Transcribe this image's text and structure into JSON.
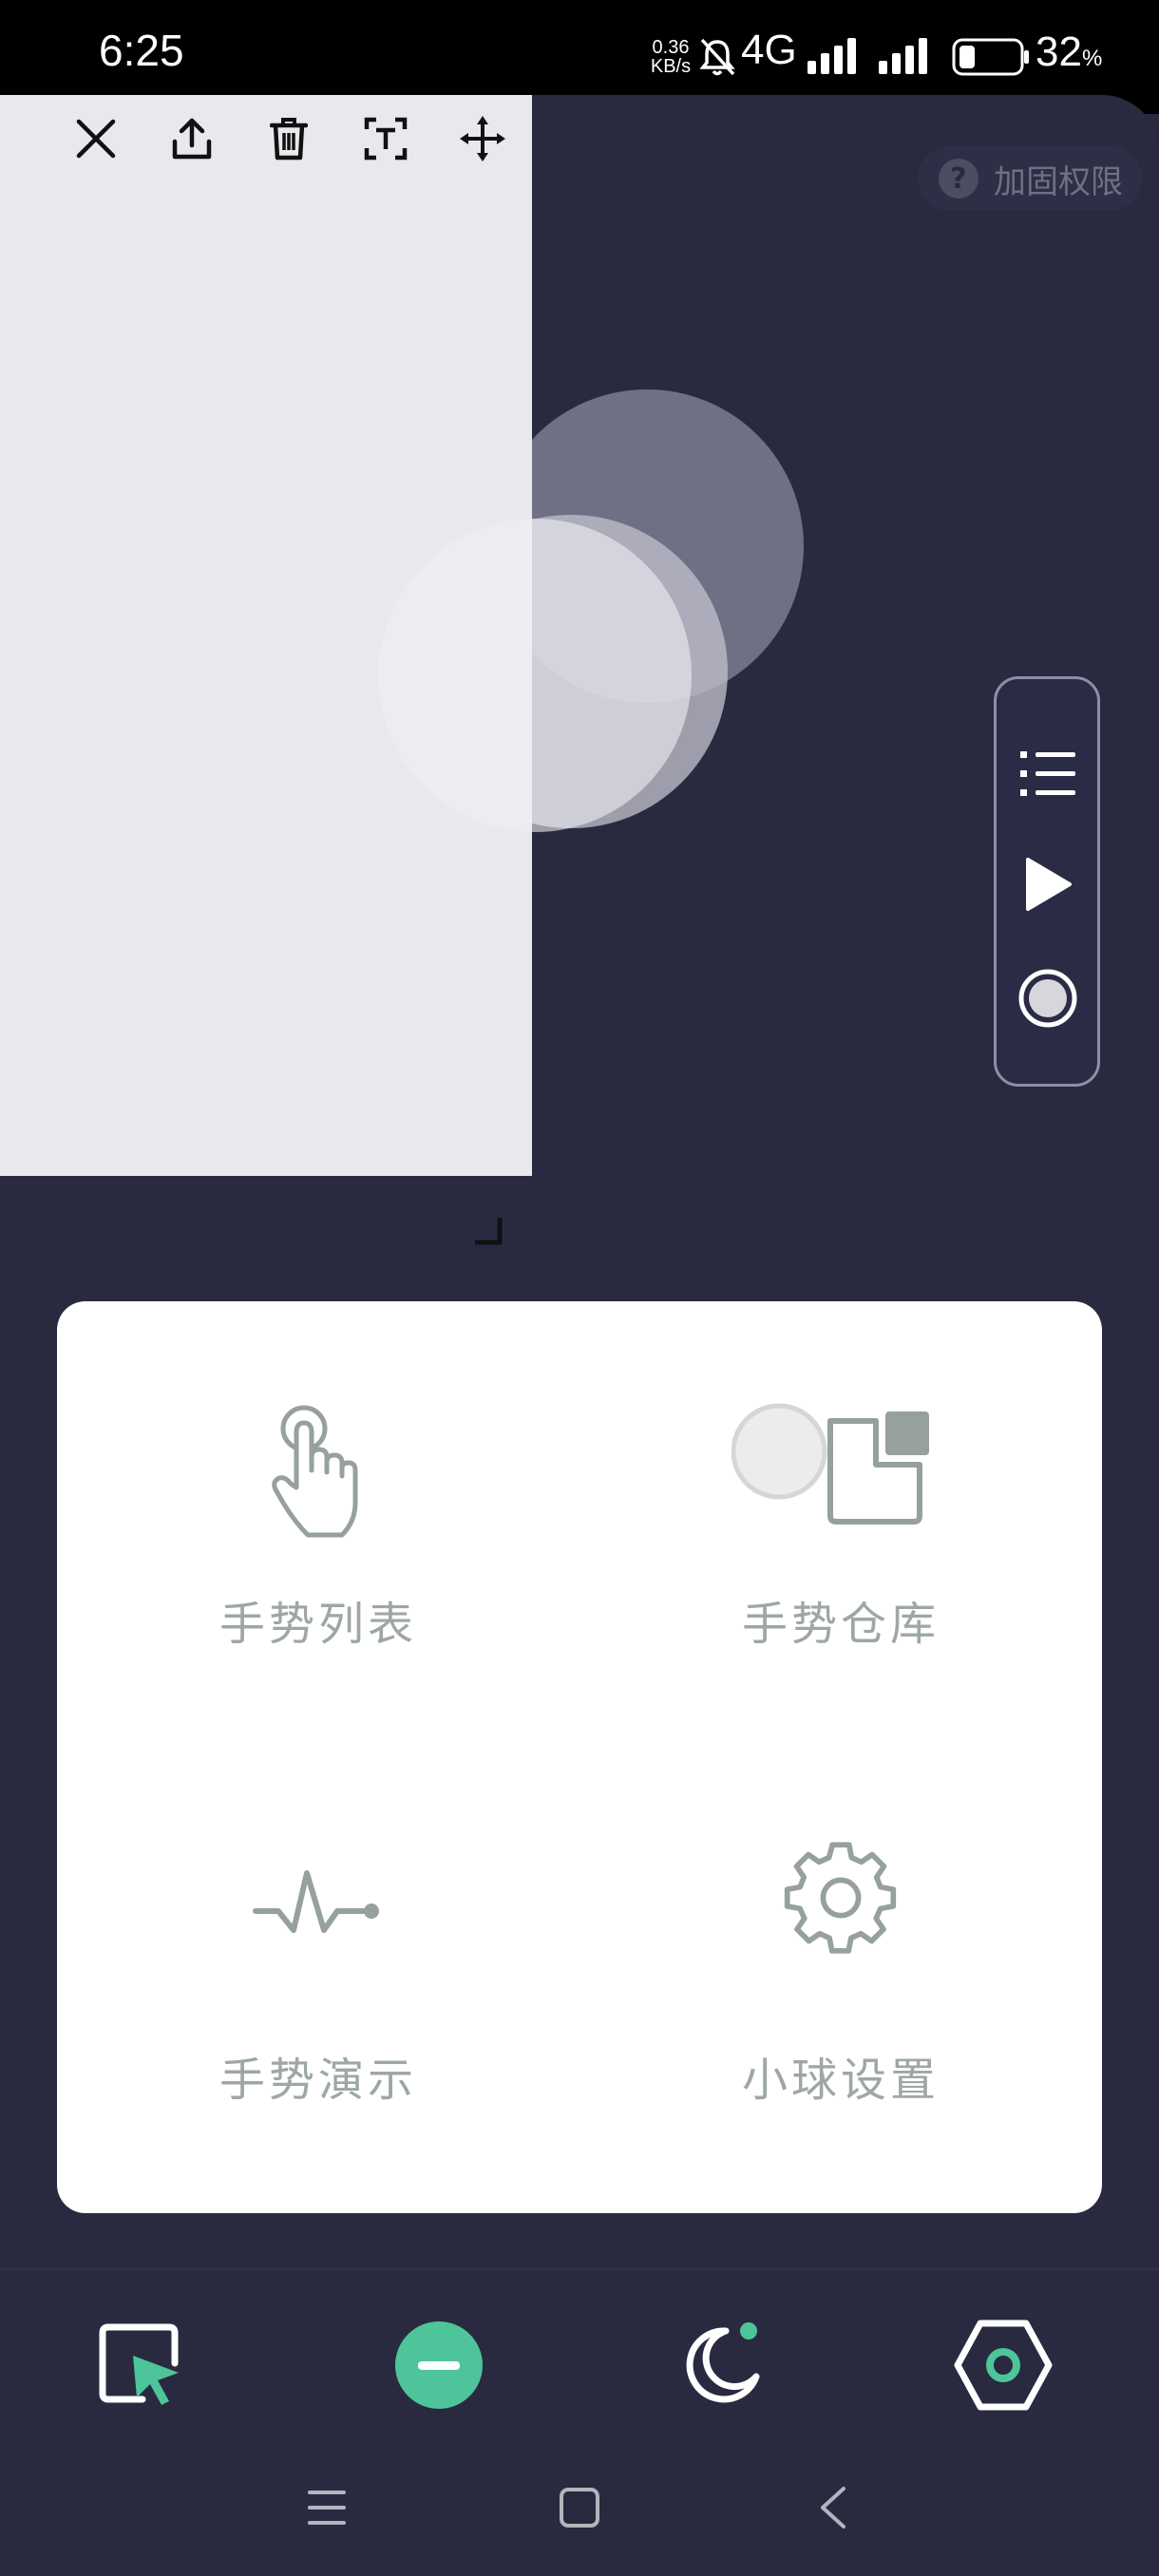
{
  "status_bar": {
    "time": "6:25",
    "net_speed_value": "0.36",
    "net_speed_unit": "KB/s",
    "network_type": "4G",
    "battery_percent": "32",
    "battery_unit": "%"
  },
  "header": {
    "reinforce_label": "加固权限",
    "reinforce_icon": "question-icon"
  },
  "overlay_toolbar": {
    "tools": [
      "close-icon",
      "share-icon",
      "delete-icon",
      "text-icon",
      "move-icon"
    ]
  },
  "float_bar": {
    "buttons": [
      "list-icon",
      "play-icon",
      "record-icon"
    ]
  },
  "menu": {
    "items": [
      {
        "label": "手势列表",
        "icon": "hand-pointer-icon"
      },
      {
        "label": "手势仓库",
        "icon": "warehouse-icon"
      },
      {
        "label": "手势演示",
        "icon": "wave-icon"
      },
      {
        "label": "小球设置",
        "icon": "gear-icon"
      }
    ]
  },
  "bottom_nav": {
    "items": [
      "select-cursor-icon",
      "minimize-icon",
      "night-mode-icon",
      "settings-hex-icon"
    ],
    "accent_color": "#4ec49a"
  },
  "colors": {
    "background": "#292a40",
    "menu_label": "#9da7a6",
    "icon_gray": "#96a09f"
  }
}
